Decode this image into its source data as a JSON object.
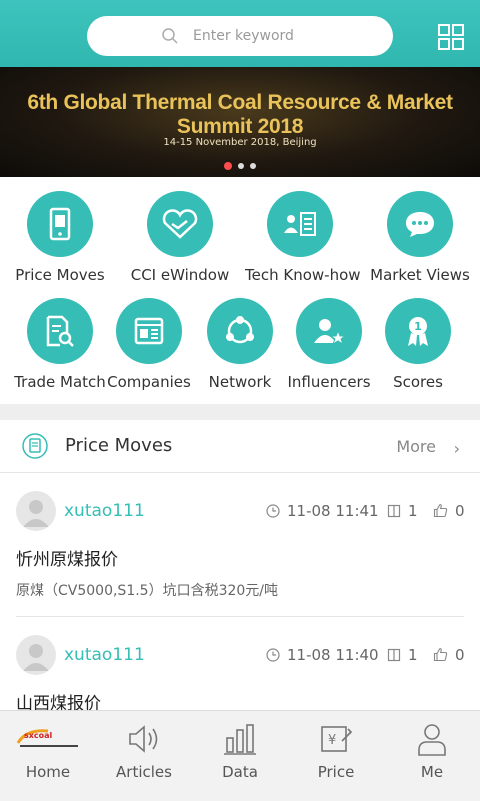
{
  "header": {
    "search_placeholder": "Enter keyword"
  },
  "banner": {
    "title": "6th Global Thermal Coal Resource & Market Summit 2018",
    "subtitle": "14-15 November 2018, Beijing",
    "active_dot": 1,
    "dot_count": 3
  },
  "categories": [
    {
      "label": "Price Moves",
      "icon": "phone-icon"
    },
    {
      "label": "CCI eWindow",
      "icon": "handshake-icon"
    },
    {
      "label": "Tech Know-how",
      "icon": "id-card-icon"
    },
    {
      "label": "Market Views",
      "icon": "chat-bubble-icon"
    },
    {
      "label": "Trade Match",
      "icon": "document-search-icon"
    },
    {
      "label": "Companies",
      "icon": "newspaper-icon"
    },
    {
      "label": "Network",
      "icon": "share-network-icon"
    },
    {
      "label": "Influencers",
      "icon": "user-star-icon"
    },
    {
      "label": "Scores",
      "icon": "medal-icon"
    }
  ],
  "section": {
    "title": "Price Moves",
    "more": "More"
  },
  "posts": [
    {
      "user": "xutao111",
      "time": "11-08 11:41",
      "comments": "1",
      "likes": "0",
      "title": "忻州原煤报价",
      "summary": "原煤（CV5000,S1.5）坑口含税320元/吨"
    },
    {
      "user": "xutao111",
      "time": "11-08 11:40",
      "comments": "1",
      "likes": "0",
      "title": "山西煤报价",
      "summary": ""
    }
  ],
  "tabs": [
    {
      "label": "Home",
      "icon": "sxcoal-logo-icon"
    },
    {
      "label": "Articles",
      "icon": "speaker-icon"
    },
    {
      "label": "Data",
      "icon": "bar-chart-icon"
    },
    {
      "label": "Price",
      "icon": "price-tag-icon"
    },
    {
      "label": "Me",
      "icon": "person-icon"
    }
  ],
  "colors": {
    "accent": "#35bdb6",
    "banner_title": "#e9c35a"
  }
}
